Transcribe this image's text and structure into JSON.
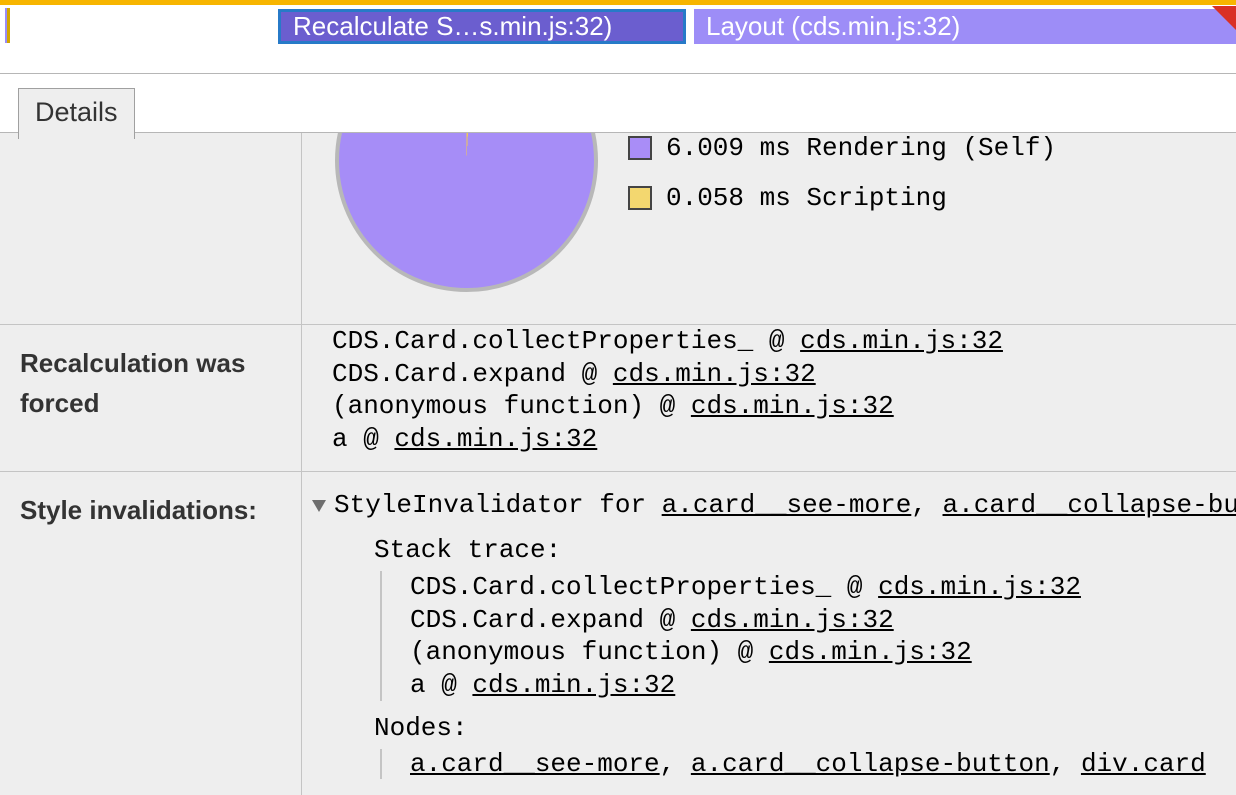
{
  "flame": {
    "selected_label": "Recalculate S…s.min.js:32)",
    "layout_label": "Layout (cds.min.js:32)"
  },
  "tabs": {
    "details": "Details"
  },
  "chart_data": {
    "type": "pie",
    "series": [
      {
        "name": "Rendering (Self)",
        "value": 6.009,
        "unit": "ms",
        "color": "#a98df7"
      },
      {
        "name": "Scripting",
        "value": 0.058,
        "unit": "ms",
        "color": "#f3d76f"
      }
    ]
  },
  "legend": {
    "rendering_text": "6.009 ms Rendering (Self)",
    "scripting_text": "0.058 ms Scripting"
  },
  "sections": {
    "forced_label": "Recalculation was forced",
    "invalidations_label": "Style invalidations:"
  },
  "forced_stack": {
    "l1_fn": "CDS.Card.collectProperties_",
    "l2_fn": "CDS.Card.expand",
    "l3_fn": "(anonymous function)",
    "l4_fn": "a",
    "at": " @ ",
    "src": "cds.min.js:32"
  },
  "invalidator": {
    "prefix": "StyleInvalidator for ",
    "sel1": "a.card__see-more",
    "sel2": "a.card__collapse-but",
    "comma": ", ",
    "stack_label": "Stack trace:",
    "nodes_label": "Nodes:",
    "node1": "a.card__see-more",
    "node2": "a.card__collapse-button",
    "node3": "div.card"
  }
}
